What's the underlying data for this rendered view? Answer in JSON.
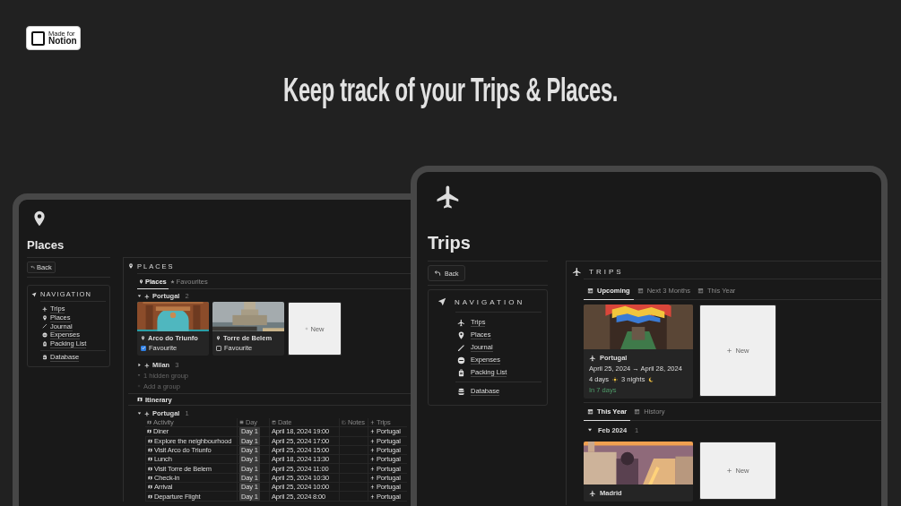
{
  "badge": {
    "line_1": "Made for",
    "line_2": "Notion"
  },
  "headline": "Keep track of your Trips & Places.",
  "places_window": {
    "title": "Places",
    "back": "Back",
    "navigation": {
      "heading": "NAVIGATION",
      "items": [
        "Trips",
        "Places",
        "Journal",
        "Expenses",
        "Packing List"
      ],
      "database": "Database"
    },
    "panel": {
      "heading": "PLACES",
      "tabs": [
        {
          "label": "Places",
          "selected": true
        },
        {
          "label": "Favourites",
          "selected": false
        }
      ],
      "groups": [
        {
          "name": "Portugal",
          "count": "2",
          "expanded": true,
          "cards": [
            {
              "title": "Arco do Triunfo",
              "favourite_label": "Favourite",
              "favourite": true
            },
            {
              "title": "Torre de Belem",
              "favourite_label": "Favourite",
              "favourite": false
            }
          ],
          "new_label": "New"
        },
        {
          "name": "Milan",
          "count": "3",
          "expanded": false
        }
      ],
      "hidden_groups": "1 hidden group",
      "add_group": "Add a group"
    },
    "itinerary": {
      "title": "Itinerary",
      "group": {
        "name": "Portugal",
        "count": "1",
        "expanded": true
      },
      "columns": [
        "Activity",
        "Day",
        "Date",
        "Notes",
        "Trips"
      ],
      "rows": [
        {
          "activity": "Diner",
          "day": "Day 1",
          "date": "April 18, 2024 19:00",
          "trip": "Portugal"
        },
        {
          "activity": "Explore the neighbourhood",
          "day": "Day 1",
          "date": "April 25, 2024 17:00",
          "trip": "Portugal"
        },
        {
          "activity": "Visit Arco do Triunfo",
          "day": "Day 1",
          "date": "April 25, 2024 15:00",
          "trip": "Portugal"
        },
        {
          "activity": "Lunch",
          "day": "Day 1",
          "date": "April 18, 2024 13:30",
          "trip": "Portugal"
        },
        {
          "activity": "Visit Torre de Belem",
          "day": "Day 1",
          "date": "April 25, 2024 11:00",
          "trip": "Portugal"
        },
        {
          "activity": "Check-in",
          "day": "Day 1",
          "date": "April 25, 2024 10:30",
          "trip": "Portugal"
        },
        {
          "activity": "Arrival",
          "day": "Day 1",
          "date": "April 25, 2024 10:00",
          "trip": "Portugal"
        },
        {
          "activity": "Departure Flight",
          "day": "Day 1",
          "date": "April 25, 2024 8:00",
          "trip": "Portugal"
        }
      ]
    }
  },
  "trips_window": {
    "title": "Trips",
    "back": "Back",
    "navigation": {
      "heading": "NAVIGATION",
      "items": [
        "Trips",
        "Places",
        "Journal",
        "Expenses",
        "Packing List"
      ],
      "database": "Database"
    },
    "panel": {
      "heading": "TRIPS",
      "views": [
        {
          "tabs": [
            {
              "label": "Upcoming",
              "selected": true
            },
            {
              "label": "Next 3 Months",
              "selected": false
            },
            {
              "label": "This Year",
              "selected": false
            }
          ],
          "cards": [
            {
              "title": "Portugal",
              "dates": "April 25, 2024 → April 28, 2024",
              "days": "4 days",
              "nights": "3 nights",
              "countdown": "In 7 days"
            }
          ],
          "new_label": "New"
        },
        {
          "tabs": [
            {
              "label": "This Year",
              "selected": true
            },
            {
              "label": "History",
              "selected": false
            }
          ],
          "group": {
            "name": "Feb 2024",
            "count": "1",
            "expanded": true
          },
          "cards": [
            {
              "title": "Madrid"
            }
          ],
          "new_label": "New"
        }
      ]
    }
  }
}
